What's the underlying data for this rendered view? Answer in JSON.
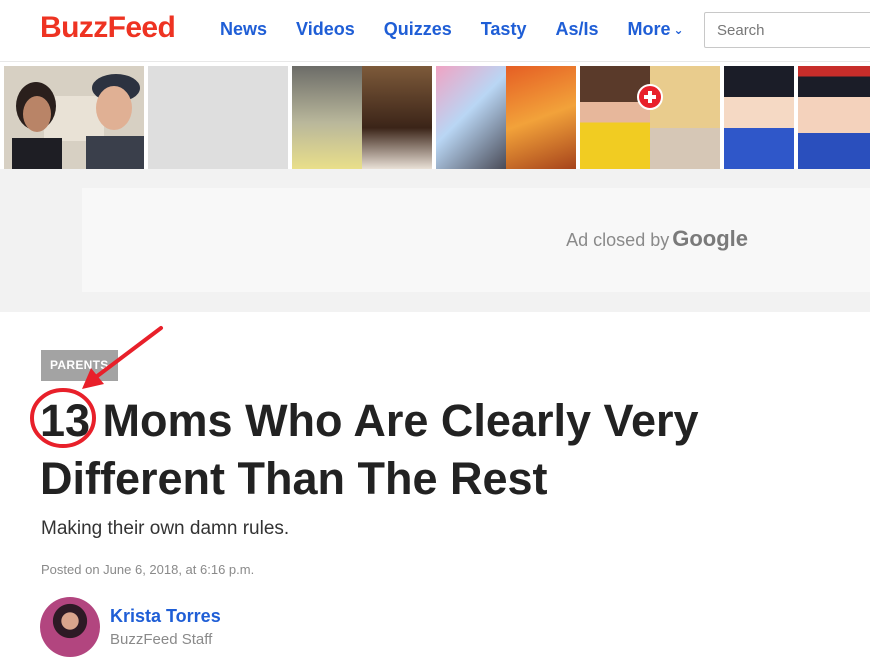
{
  "header": {
    "logo": "BuzzFeed",
    "nav": [
      {
        "label": "News"
      },
      {
        "label": "Videos"
      },
      {
        "label": "Quizzes"
      },
      {
        "label": "Tasty"
      },
      {
        "label": "As/Is"
      },
      {
        "label": "More"
      }
    ],
    "search_placeholder": "Search"
  },
  "ad": {
    "closed_label": "Ad closed by",
    "brand": "Google"
  },
  "article": {
    "category": "PARENTS",
    "title": "13 Moms Who Are Clearly Very Different Than The Rest",
    "subtitle": "Making their own damn rules.",
    "posted": "Posted on June 6, 2018, at 6:16 p.m.",
    "author": {
      "name": "Krista Torres",
      "role": "BuzzFeed Staff"
    }
  },
  "colors": {
    "brand_red": "#ee3322",
    "link_blue": "#1f5ed6",
    "annotation_red": "#e8202a"
  },
  "icons": [
    "chevron-down-icon",
    "plus-badge-icon"
  ]
}
